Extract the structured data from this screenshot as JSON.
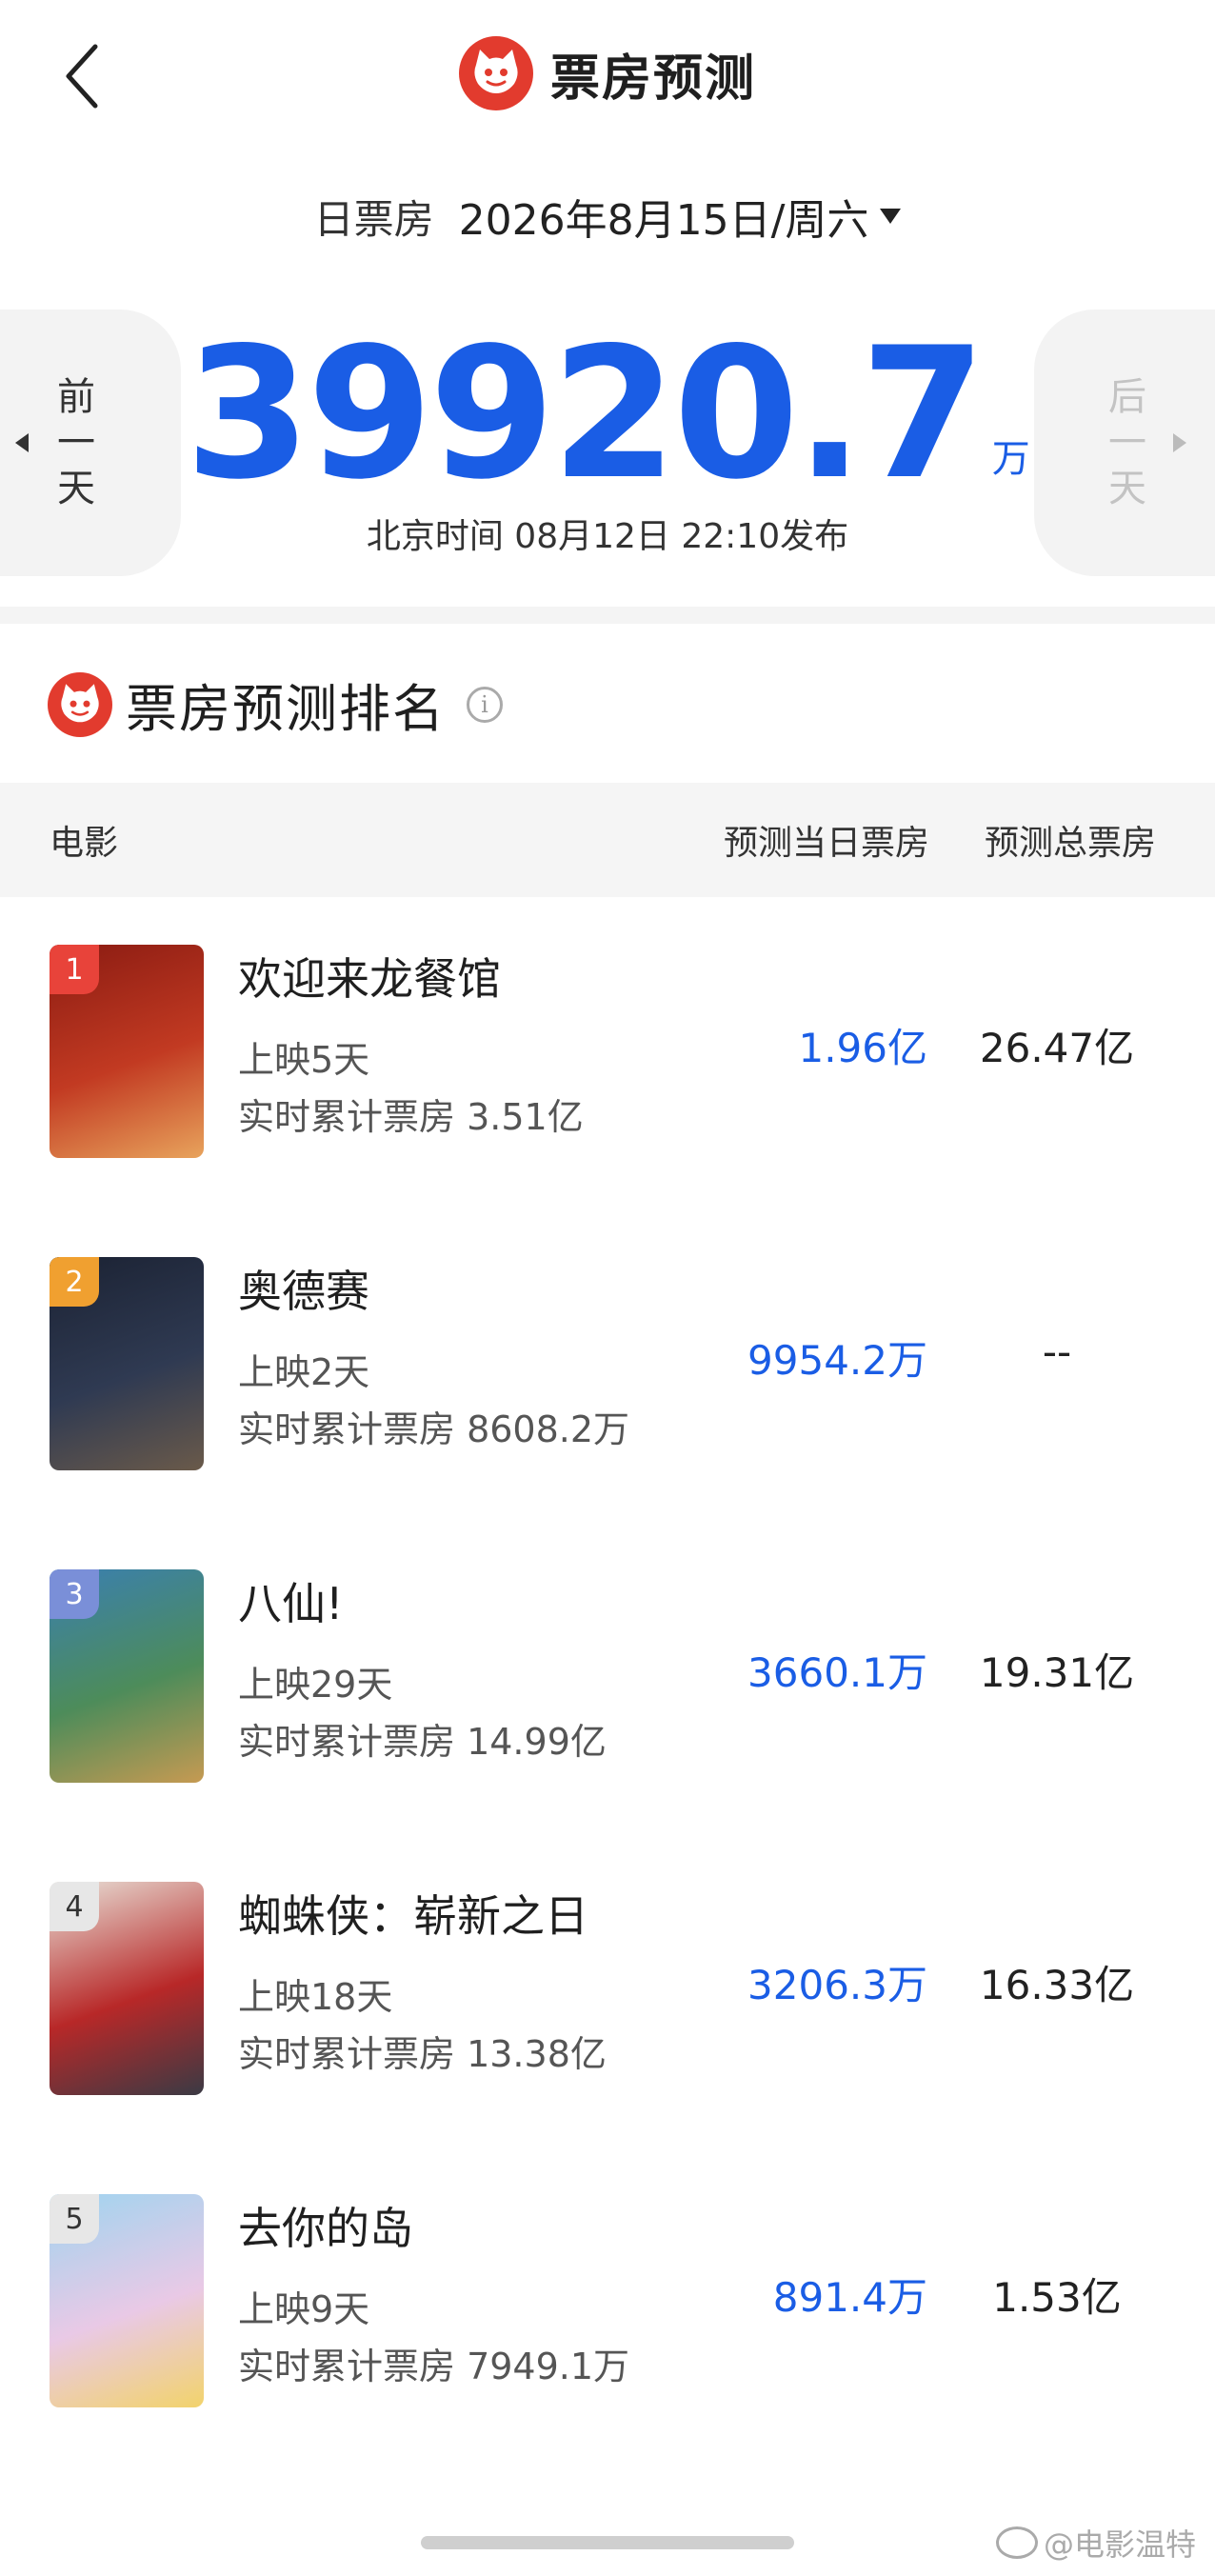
{
  "header": {
    "title": "票房预测",
    "back_icon": "chevron-left-icon",
    "logo_icon": "cat-logo-icon"
  },
  "date_bar": {
    "type_label": "日票房",
    "date": "2026年8月15日/周六"
  },
  "nav": {
    "prev_label_1": "前",
    "prev_label_2": "一",
    "prev_label_3": "天",
    "next_label_1": "后",
    "next_label_2": "一",
    "next_label_3": "天"
  },
  "summary": {
    "total": "39920.7",
    "unit": "万",
    "publish_info": "北京时间  08月12日  22:10发布"
  },
  "ranking": {
    "title": "票房预测排名",
    "columns": {
      "movie": "电影",
      "day": "预测当日票房",
      "total": "预测总票房"
    },
    "rows": [
      {
        "rank": "1",
        "name": "欢迎来龙餐馆",
        "days": "上映5天",
        "realtime": "实时累计票房 3.51亿",
        "pred_day": "1.96亿",
        "pred_total": "26.47亿",
        "badge_color": "#e8433a",
        "poster_colors": [
          "#8a1b12",
          "#c23a22",
          "#e8a35c"
        ]
      },
      {
        "rank": "2",
        "name": "奥德赛",
        "days": "上映2天",
        "realtime": "实时累计票房 8608.2万",
        "pred_day": "9954.2万",
        "pred_total": "--",
        "badge_color": "#f0a030",
        "poster_colors": [
          "#1b2233",
          "#2f3a52",
          "#6a5a4a"
        ]
      },
      {
        "rank": "3",
        "name": "八仙!",
        "days": "上映29天",
        "realtime": "实时累计票房 14.99亿",
        "pred_day": "3660.1万",
        "pred_total": "19.31亿",
        "badge_color": "#7a8fd8",
        "poster_colors": [
          "#3a7fb0",
          "#4d8c5a",
          "#c69a52"
        ]
      },
      {
        "rank": "4",
        "name": "蜘蛛侠：崭新之日",
        "days": "上映18天",
        "realtime": "实时累计票房 13.38亿",
        "pred_day": "3206.3万",
        "pred_total": "16.33亿",
        "badge_color": "#e7e7e7",
        "poster_colors": [
          "#e9e3da",
          "#b82828",
          "#3a3a44"
        ]
      },
      {
        "rank": "5",
        "name": "去你的岛",
        "days": "上映9天",
        "realtime": "实时累计票房 7949.1万",
        "pred_day": "891.4万",
        "pred_total": "1.53亿",
        "badge_color": "#e7e7e7",
        "poster_colors": [
          "#9fd4ef",
          "#e9c9e6",
          "#f2d36b"
        ]
      }
    ]
  },
  "watermark": "@电影温特"
}
